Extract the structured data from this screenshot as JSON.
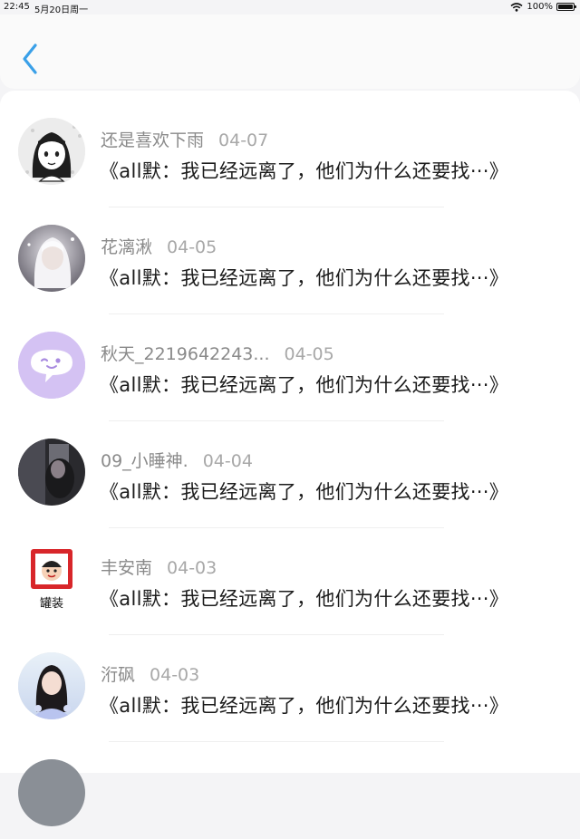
{
  "status_bar": {
    "time": "22:45",
    "date": "5月20日周一",
    "battery": "100%"
  },
  "nav": {
    "back_icon": "chevron-left-icon"
  },
  "list": [
    {
      "name": "还是喜欢下雨",
      "date": "04-07",
      "text": "《all默：我已经远离了，他们为什么还要找···》",
      "avatar": "manga-girl-avatar"
    },
    {
      "name": "花漓湫",
      "date": "04-05",
      "text": "《all默：我已经远离了，他们为什么还要找···》",
      "avatar": "white-hair-girl-avatar"
    },
    {
      "name": "秋天_2219642243...",
      "date": "04-05",
      "text": "《all默：我已经远离了，他们为什么还要找···》",
      "avatar": "chat-bubble-avatar"
    },
    {
      "name": "09_小睡神.",
      "date": "04-04",
      "text": "《all默：我已经远离了，他们为什么还要找···》",
      "avatar": "dark-photo-avatar"
    },
    {
      "name": "丰安南",
      "date": "04-03",
      "text": "《all默：我已经远离了，他们为什么还要找···》",
      "avatar": "canned-sticker-avatar"
    },
    {
      "name": "洐砜",
      "date": "04-03",
      "text": "《all默：我已经远离了，他们为什么还要找···》",
      "avatar": "girl-photo-avatar"
    }
  ]
}
